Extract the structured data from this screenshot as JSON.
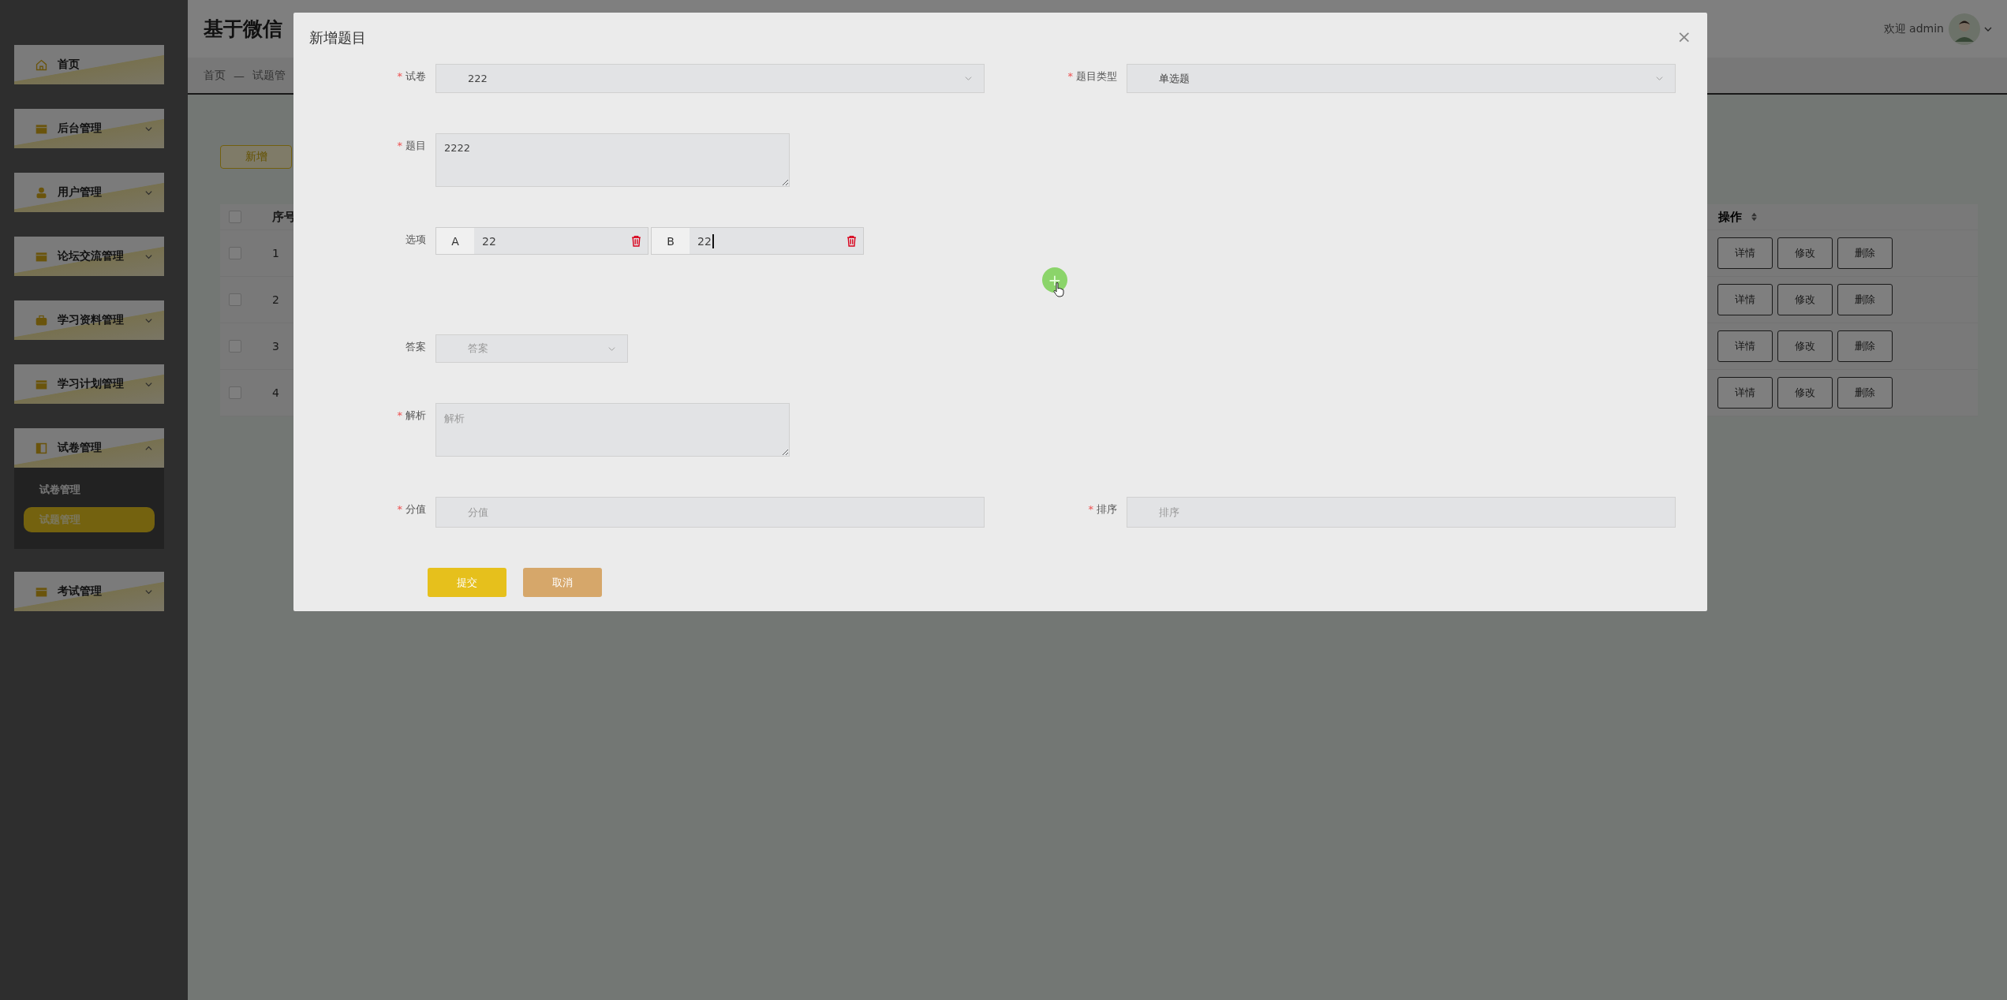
{
  "sidebar": {
    "items": [
      {
        "label": "首页"
      },
      {
        "label": "后台管理",
        "expanded": false
      },
      {
        "label": "用户管理",
        "expanded": false
      },
      {
        "label": "论坛交流管理",
        "expanded": false
      },
      {
        "label": "学习资料管理",
        "expanded": false
      },
      {
        "label": "学习计划管理",
        "expanded": false
      },
      {
        "label": "试卷管理",
        "expanded": true,
        "children": [
          {
            "label": "试卷管理",
            "selected": false
          },
          {
            "label": "试题管理",
            "selected": true
          }
        ]
      },
      {
        "label": "考试管理",
        "expanded": false
      }
    ]
  },
  "header": {
    "title": "基于微信",
    "greeting": "欢迎 admin"
  },
  "breadcrumb": {
    "items": [
      "首页",
      "试题管"
    ],
    "separator": "—"
  },
  "toolbar": {
    "add_button": "新增"
  },
  "table": {
    "all_checked": false,
    "columns": [
      {
        "label": "序号"
      },
      {
        "label": "操作"
      }
    ],
    "rows": [
      {
        "checked": false,
        "index": "1",
        "actions": [
          "详情",
          "修改",
          "删除"
        ]
      },
      {
        "checked": false,
        "index": "2",
        "actions": [
          "详情",
          "修改",
          "删除"
        ]
      },
      {
        "checked": false,
        "index": "3",
        "actions": [
          "详情",
          "修改",
          "删除"
        ]
      },
      {
        "checked": false,
        "index": "4",
        "actions": [
          "详情",
          "修改",
          "删除"
        ]
      }
    ]
  },
  "dialog": {
    "title": "新增题目",
    "close": "×",
    "rows": [
      [
        {
          "label": "试卷",
          "required_mark": "*",
          "kind": "select",
          "value": "222"
        },
        {
          "label": "题目类型",
          "required_mark": "*",
          "kind": "select",
          "value": "单选题"
        }
      ],
      [
        {
          "label": "题目",
          "required_mark": "*",
          "kind": "textarea",
          "value": "2222"
        }
      ],
      [
        {
          "label": "选项",
          "kind": "options",
          "options": [
            {
              "letter": "A",
              "value": "22",
              "focused": false
            },
            {
              "letter": "B",
              "value": "22",
              "focused": true
            }
          ],
          "add_button": "+"
        }
      ],
      [
        {
          "label": "答案",
          "kind": "select-small",
          "placeholder": "答案"
        }
      ],
      [
        {
          "label": "解析",
          "required_mark": "*",
          "kind": "textarea",
          "placeholder": "解析"
        }
      ],
      [
        {
          "label": "分值",
          "required_mark": "*",
          "kind": "input",
          "placeholder": "分值"
        },
        {
          "label": "排序",
          "required_mark": "*",
          "kind": "input",
          "placeholder": "排序"
        }
      ]
    ],
    "buttons": [
      {
        "label": "提交",
        "kind": "primary"
      },
      {
        "label": "取消",
        "kind": "secondary"
      }
    ]
  }
}
